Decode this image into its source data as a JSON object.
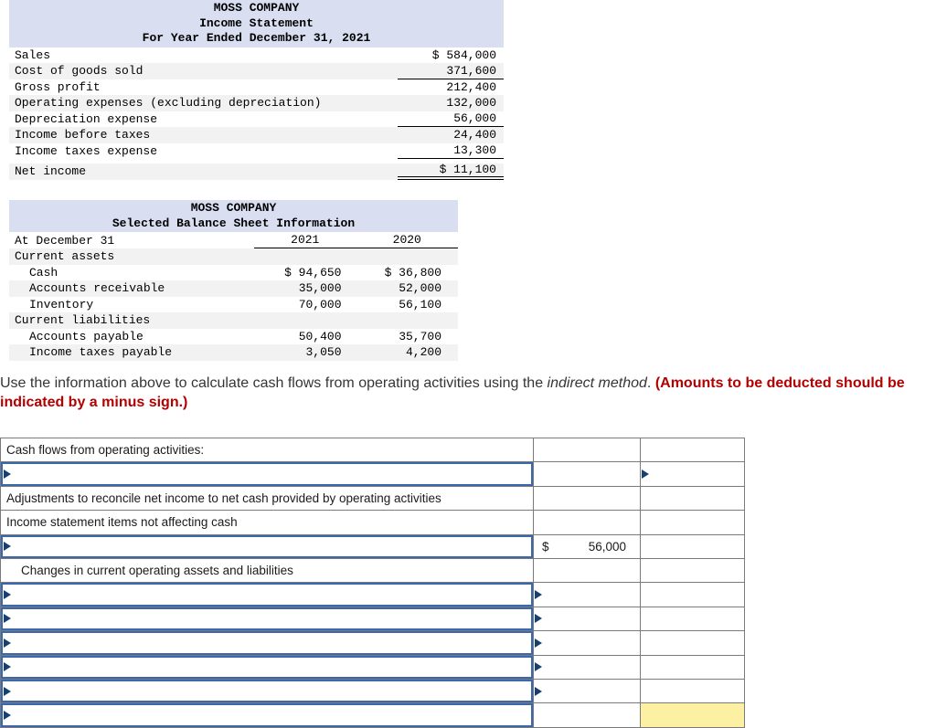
{
  "income_statement": {
    "header": [
      "MOSS COMPANY",
      "Income Statement",
      "For Year Ended December 31, 2021"
    ],
    "rows": [
      {
        "label": "Sales",
        "amount": "$ 584,000",
        "underline": "none",
        "shaded": false
      },
      {
        "label": "Cost of goods sold",
        "amount": "371,600",
        "underline": "single",
        "shaded": true
      },
      {
        "label": "Gross profit",
        "amount": "212,400",
        "underline": "none",
        "shaded": false
      },
      {
        "label": "Operating expenses (excluding depreciation)",
        "amount": "132,000",
        "underline": "none",
        "shaded": true
      },
      {
        "label": "Depreciation expense",
        "amount": "56,000",
        "underline": "single",
        "shaded": false
      },
      {
        "label": "Income before taxes",
        "amount": "24,400",
        "underline": "none",
        "shaded": true
      },
      {
        "label": "Income taxes expense",
        "amount": "13,300",
        "underline": "single",
        "shaded": false
      },
      {
        "label": "Net income",
        "amount": "$ 11,100",
        "underline": "double",
        "shaded": true,
        "gap_before": true
      }
    ]
  },
  "balance_sheet": {
    "header": [
      "MOSS COMPANY",
      "Selected Balance Sheet Information"
    ],
    "col_header_row": {
      "label": "At December 31",
      "col1": "2021",
      "col2": "2020"
    },
    "rows": [
      {
        "label": "Current assets",
        "indent": 0,
        "v2021": "",
        "v2020": "",
        "shaded": true
      },
      {
        "label": "Cash",
        "indent": 1,
        "v2021": "$ 94,650",
        "v2020": "$ 36,800",
        "shaded": false
      },
      {
        "label": "Accounts receivable",
        "indent": 1,
        "v2021": "35,000",
        "v2020": "52,000",
        "shaded": true
      },
      {
        "label": "Inventory",
        "indent": 1,
        "v2021": "70,000",
        "v2020": "56,100",
        "shaded": false
      },
      {
        "label": "Current liabilities",
        "indent": 0,
        "v2021": "",
        "v2020": "",
        "shaded": true
      },
      {
        "label": "Accounts payable",
        "indent": 1,
        "v2021": "50,400",
        "v2020": "35,700",
        "shaded": false
      },
      {
        "label": "Income taxes payable",
        "indent": 1,
        "v2021": "3,050",
        "v2020": "4,200",
        "shaded": true
      }
    ]
  },
  "instruction": {
    "normal_1": "Use the information above to calculate cash flows from operating activities using the ",
    "italic": "indirect method",
    "normal_2": ". ",
    "red_bold": "(Amounts to be deducted should be indicated by a minus sign.)"
  },
  "worksheet": {
    "rows": [
      {
        "type": "label",
        "label": "Cash flows from operating activities:",
        "indent": 0
      },
      {
        "type": "input",
        "marker": "right"
      },
      {
        "type": "label",
        "label": "Adjustments to reconcile net income to net cash provided by operating activities",
        "indent": 0
      },
      {
        "type": "label",
        "label": "Income statement items not affecting cash",
        "indent": 0
      },
      {
        "type": "input",
        "mid_dollar": "$",
        "mid_value": "56,000"
      },
      {
        "type": "label",
        "label": "Changes in current operating assets and liabilities",
        "indent": 1
      },
      {
        "type": "input",
        "marker": "mid"
      },
      {
        "type": "input",
        "marker": "mid"
      },
      {
        "type": "input",
        "marker": "mid"
      },
      {
        "type": "input",
        "marker": "mid"
      },
      {
        "type": "input",
        "marker": "mid"
      },
      {
        "type": "input",
        "yellow": true
      }
    ]
  },
  "colors": {
    "table_header_fill": "#d9dff0",
    "row_shade": "#f2f2f2",
    "grid_line": "#7a7a7a",
    "input_border_blue": "#3a67ad",
    "marker_navy": "#17406e",
    "highlight_yellow": "#fcf0a3",
    "instruction_red": "#b30000"
  }
}
